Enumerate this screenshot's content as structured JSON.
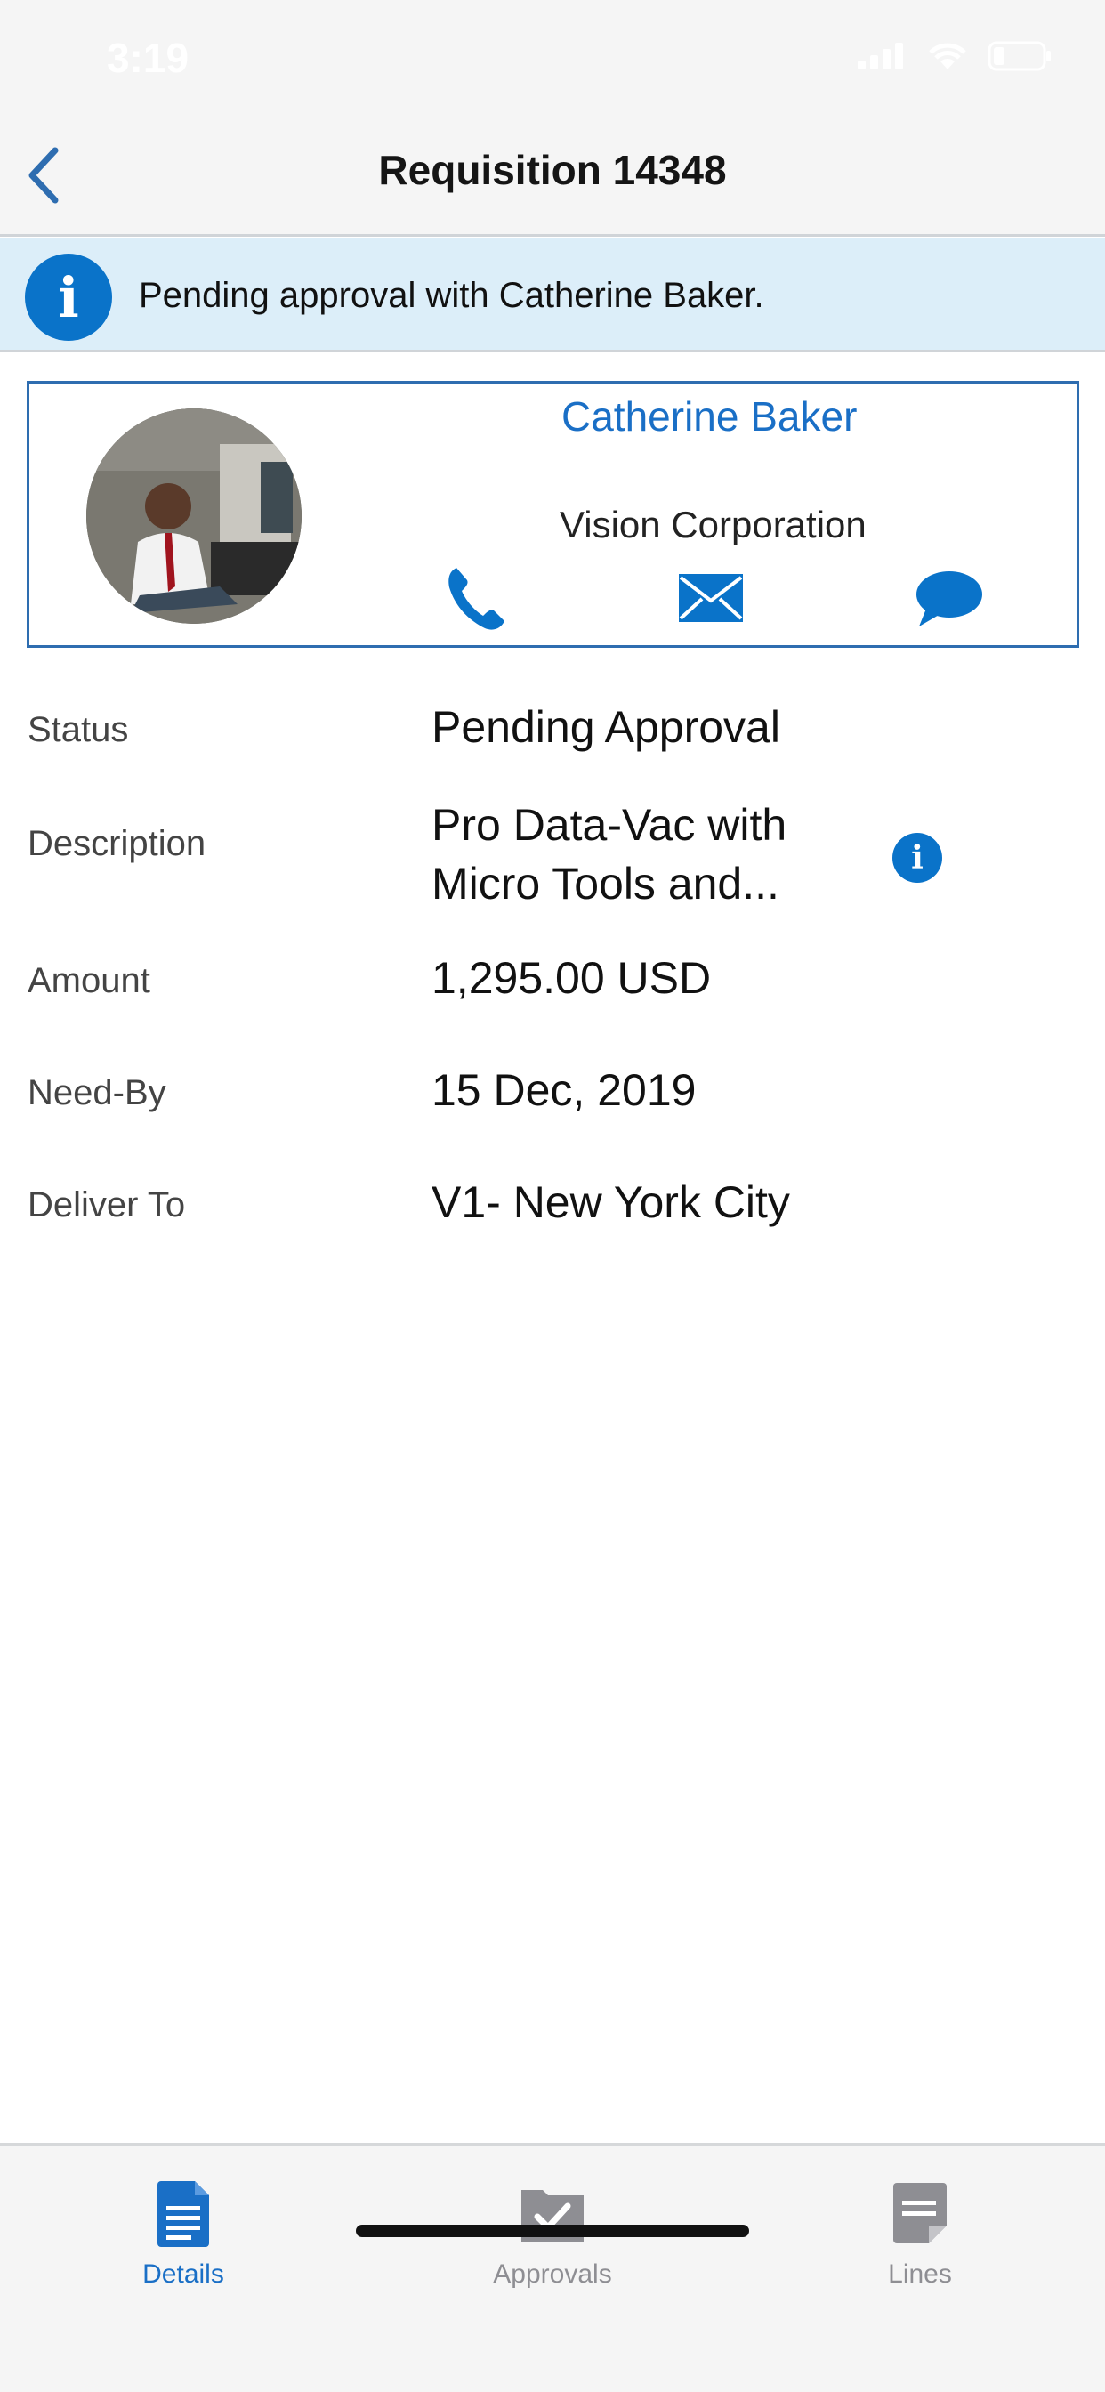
{
  "status_bar": {
    "time": "3:19"
  },
  "nav": {
    "title": "Requisition 14348"
  },
  "banner": {
    "message": "Pending approval with Catherine Baker."
  },
  "contact": {
    "name": "Catherine Baker",
    "organization": "Vision Corporation"
  },
  "details": {
    "status_label": "Status",
    "status_value": "Pending Approval",
    "description_label": "Description",
    "description_line1": "Pro Data-Vac with",
    "description_line2": "Micro Tools and...",
    "amount_label": "Amount",
    "amount_value": "1,295.00 USD",
    "need_by_label": "Need-By",
    "need_by_value": "15 Dec, 2019",
    "deliver_to_label": "Deliver To",
    "deliver_to_value": "V1- New York City"
  },
  "tabs": [
    {
      "label": "Details",
      "icon": "document-icon",
      "active": true
    },
    {
      "label": "Approvals",
      "icon": "approval-box-icon",
      "active": false
    },
    {
      "label": "Lines",
      "icon": "lines-note-icon",
      "active": false
    }
  ],
  "colors": {
    "accent": "#1a6fc6",
    "banner_bg": "#dceef9",
    "info_icon": "#0a73c9"
  }
}
